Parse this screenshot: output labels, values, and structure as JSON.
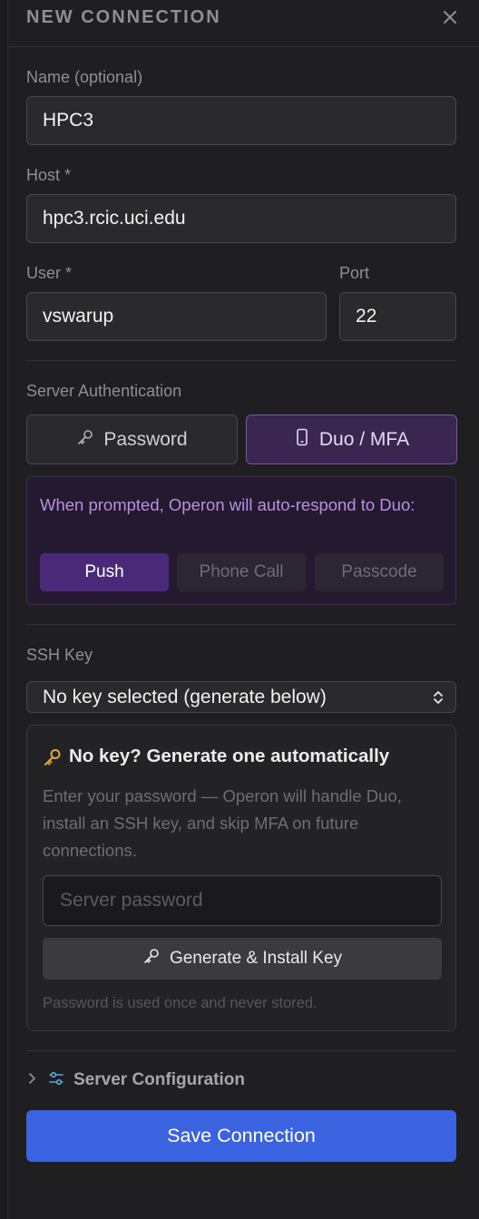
{
  "header": {
    "title": "NEW CONNECTION"
  },
  "fields": {
    "name_label": "Name (optional)",
    "name_value": "HPC3",
    "host_label": "Host *",
    "host_value": "hpc3.rcic.uci.edu",
    "user_label": "User *",
    "user_value": "vswarup",
    "port_label": "Port",
    "port_value": "22"
  },
  "auth": {
    "section_label": "Server Authentication",
    "password_label": "Password",
    "duo_label": "Duo / MFA",
    "selected": "Duo / MFA",
    "duo_text": "When prompted, Operon will auto-respond to Duo:",
    "duo_options": [
      "Push",
      "Phone Call",
      "Passcode"
    ],
    "duo_selected": "Push"
  },
  "ssh": {
    "section_label": "SSH Key",
    "select_value": "No key selected (generate below)",
    "generate_title": "No key? Generate one automatically",
    "generate_desc": "Enter your password — Operon will handle Duo, install an SSH key, and skip MFA on future connections.",
    "password_placeholder": "Server password",
    "generate_button": "Generate & Install Key",
    "note": "Password is used once and never stored."
  },
  "config": {
    "label": "Server Configuration"
  },
  "save_button": "Save Connection",
  "colors": {
    "accent_blue": "#3b63e0",
    "duo_purple": "#7b4fb5",
    "key_gold": "#e0a93b",
    "config_icon": "#5aa8e0"
  }
}
